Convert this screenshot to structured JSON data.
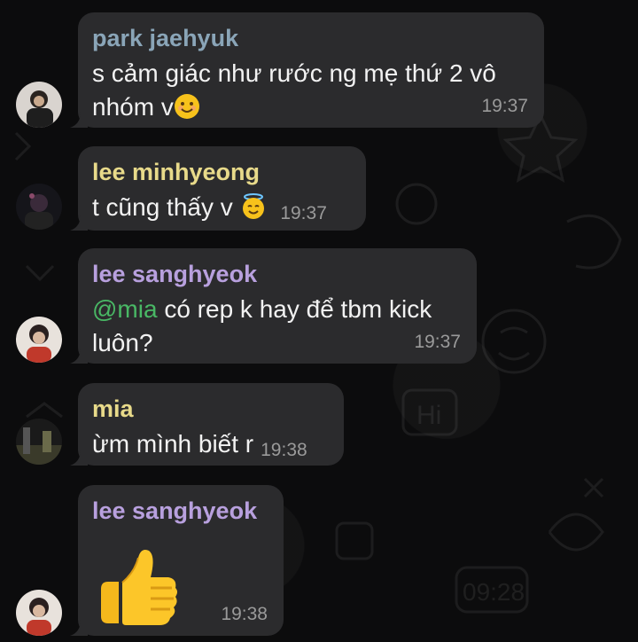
{
  "chat": {
    "messages": [
      {
        "sender": "park jaehyuk",
        "sender_color": "#8aa5b8",
        "text_parts": [
          "s cảm giác như rước ng mẹ thứ 2 vô",
          "nhóm v"
        ],
        "emoji": "smiling-face-icon",
        "time": "19:37"
      },
      {
        "sender": "lee minhyeong",
        "sender_color": "#e8da8a",
        "text": "t cũng thấy v",
        "emoji": "halo-face-icon",
        "time": "19:37"
      },
      {
        "sender": "lee sanghyeok",
        "sender_color": "#b8a0de",
        "mention": "@mia",
        "text_parts": [
          " có rep k hay để tbm kick",
          "luôn?"
        ],
        "time": "19:37"
      },
      {
        "sender": "mia",
        "sender_color": "#e8da8a",
        "text": "ừm mình biết r",
        "time": "19:38"
      },
      {
        "sender": "lee sanghyeok",
        "sender_color": "#b8a0de",
        "sticker": "thumbs-up-icon",
        "time": "19:38"
      }
    ]
  }
}
